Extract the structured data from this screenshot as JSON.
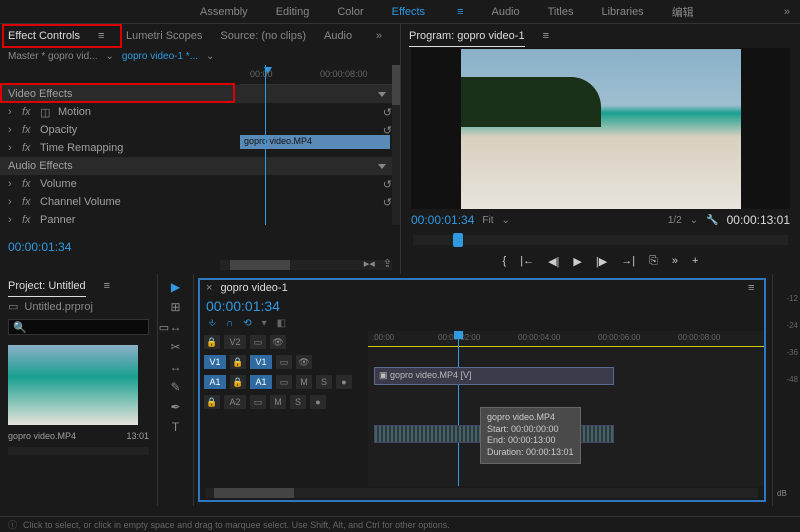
{
  "topTabs": {
    "items": [
      "Assembly",
      "Editing",
      "Color",
      "Effects",
      "Audio",
      "Titles",
      "Libraries",
      "编辑"
    ],
    "activeIndex": 3
  },
  "panels": {
    "left": {
      "tabs": [
        "Effect Controls",
        "Lumetri Scopes",
        "Source: (no clips)",
        "Audio"
      ],
      "activeIndex": 0
    },
    "program": {
      "title": "Program: gopro video-1"
    }
  },
  "effectControls": {
    "masterLabel": "Master * gopro vid...",
    "sequenceLabel": "gopro video-1 *...",
    "clipBar": "gopro video.MP4",
    "ruler": {
      "t1": "00:00",
      "t2": "00:00:08:00"
    },
    "sections": {
      "videoEffects": "Video Effects",
      "audioEffects": "Audio Effects"
    },
    "video": [
      {
        "label": "Motion",
        "hasBox": true,
        "reset": true
      },
      {
        "label": "Opacity",
        "reset": true
      },
      {
        "label": "Time Remapping"
      }
    ],
    "audio": [
      {
        "label": "Volume",
        "reset": true
      },
      {
        "label": "Channel Volume",
        "reset": true
      },
      {
        "label": "Panner"
      }
    ],
    "timecode": "00:00:01:34"
  },
  "program": {
    "timecode": "00:00:01:34",
    "fit": "Fit",
    "zoom": "1/2",
    "duration": "00:00:13:01",
    "transport": {
      "markIn": "{",
      "stepBack": "|←",
      "frameBack": "◀|",
      "play": "▶",
      "frameFwd": "|▶",
      "stepFwd": "→|",
      "export": "⎘",
      "overflow": "»",
      "add": "+"
    }
  },
  "project": {
    "panelTitle": "Project: Untitled",
    "fileName": "Untitled.prproj",
    "searchPlaceholder": "",
    "item": {
      "name": "gopro video.MP4",
      "dur": "13:01"
    }
  },
  "tools": [
    "▲",
    "⊞",
    "✂",
    "↔",
    "✎",
    "✒",
    "T"
  ],
  "sequence": {
    "name": "gopro video-1",
    "timecode": "00:00:01:34",
    "iconRow": [
      "⎀",
      "∩",
      "⟲",
      "▾",
      "◧"
    ],
    "ruler": [
      ":00:00",
      "00:00:02:00",
      "00:00:04:00",
      "00:00:06:00",
      "00:00:08:00"
    ],
    "tracks": {
      "v2": "V2",
      "v1": "V1",
      "a1": "A1",
      "a2": "A2",
      "lock": "🔒",
      "eye": "👁",
      "mute": "M",
      "solo": "S"
    },
    "clipV": "gopro video.MP4 [V]",
    "tooltip": "gopro video.MP4\nStart: 00:00:00:00\nEnd: 00:00:13:00\nDuration: 00:00:13:01"
  },
  "meters": {
    "ticks": [
      "-12",
      "-24",
      "-36",
      "-48"
    ],
    "label": "dB"
  },
  "statusBar": {
    "hint": "Click to select, or click in empty space and drag to marquee select. Use Shift, Alt, and Ctrl for other options."
  },
  "icons": {
    "menu": "≡",
    "caret": "⌄",
    "overflow": "»",
    "reset": "↺",
    "triUp": "▲",
    "share": "⇪",
    "step": "▸◂",
    "search": "🔍",
    "bin": "▭",
    "wrench": "🔧",
    "close": "×",
    "selection": "▶"
  }
}
